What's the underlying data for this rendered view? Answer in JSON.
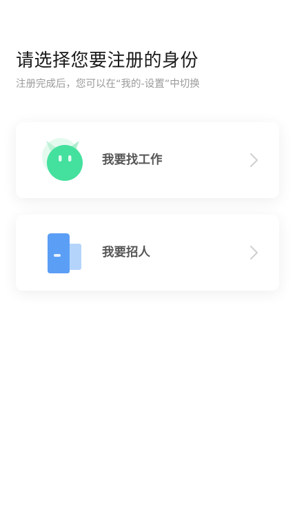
{
  "header": {
    "title": "请选择您要注册的身份",
    "subtitle": "注册完成后，您可以在“我的-设置”中切换"
  },
  "options": [
    {
      "label": "我要找工作",
      "icon": "green-monster-avatar-icon",
      "icon_color": "#44e09e"
    },
    {
      "label": "我要招人",
      "icon": "blue-door-icon",
      "icon_color": "#5b9ef5"
    }
  ],
  "colors": {
    "title": "#1a1a1a",
    "subtitle": "#9a9a9a",
    "label": "#555555",
    "chevron": "#cfcfcf",
    "background": "#ffffff"
  }
}
